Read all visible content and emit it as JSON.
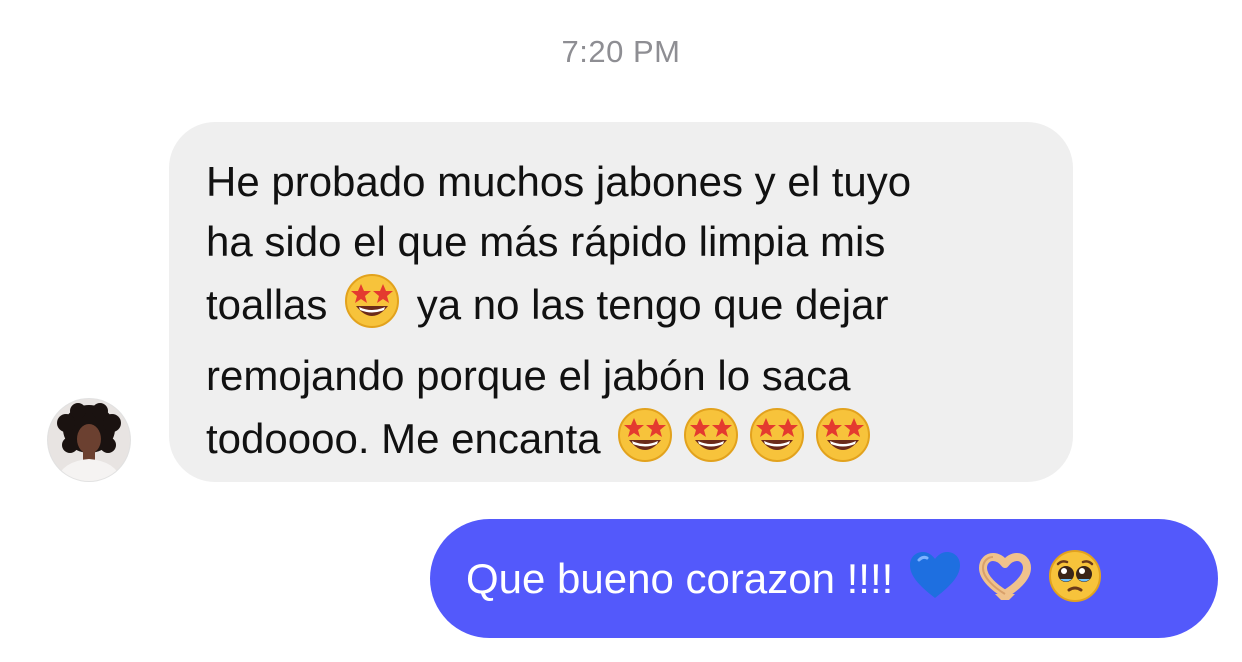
{
  "timestamp": "7:20 PM",
  "incoming_message": {
    "avatar_icon": "profile-avatar",
    "line1": "He probado muchos jabones y el tuyo",
    "line2": "ha sido el que más rápido limpia mis",
    "line3a": "toallas",
    "line3b": "ya no las tengo que dejar",
    "line4": "remojando porque el jabón lo saca",
    "line5": "todoooo. Me encanta",
    "emoji": "star-struck-emoji",
    "bubble_color": "#efefef"
  },
  "outgoing_message": {
    "text": "Que bueno corazon !!!!",
    "emojis": [
      "blue-heart-emoji",
      "heart-hands-emoji",
      "pleading-face-emoji"
    ],
    "bubble_color": "#5359fb"
  }
}
